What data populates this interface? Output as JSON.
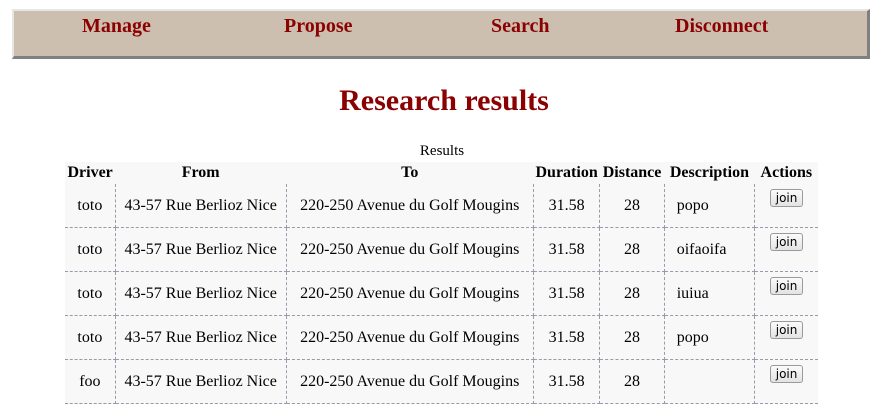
{
  "nav": {
    "manage": "Manage",
    "propose": "Propose",
    "search": "Search",
    "disconnect": "Disconnect"
  },
  "title": "Research results",
  "table": {
    "caption": "Results",
    "headers": [
      "Driver",
      "From",
      "To",
      "Duration",
      "Distance",
      "Description",
      "Actions"
    ],
    "join_label": "join",
    "rows": [
      {
        "driver": "toto",
        "from": "43-57 Rue Berlioz Nice",
        "to": "220-250 Avenue du Golf Mougins",
        "duration": "31.58",
        "distance": "28",
        "description": "popo"
      },
      {
        "driver": "toto",
        "from": "43-57 Rue Berlioz Nice",
        "to": "220-250 Avenue du Golf Mougins",
        "duration": "31.58",
        "distance": "28",
        "description": "oifaoifa"
      },
      {
        "driver": "toto",
        "from": "43-57 Rue Berlioz Nice",
        "to": "220-250 Avenue du Golf Mougins",
        "duration": "31.58",
        "distance": "28",
        "description": "iuiua"
      },
      {
        "driver": "toto",
        "from": "43-57 Rue Berlioz Nice",
        "to": "220-250 Avenue du Golf Mougins",
        "duration": "31.58",
        "distance": "28",
        "description": "popo"
      },
      {
        "driver": "foo",
        "from": "43-57 Rue Berlioz Nice",
        "to": "220-250 Avenue du Golf Mougins",
        "duration": "31.58",
        "distance": "28",
        "description": ""
      }
    ]
  }
}
